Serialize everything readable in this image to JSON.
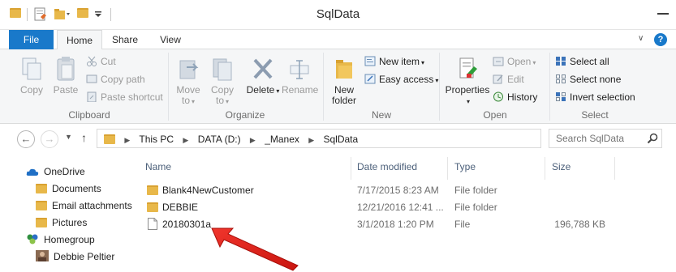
{
  "window": {
    "title": "SqlData"
  },
  "tabs": {
    "file": "File",
    "home": "Home",
    "share": "Share",
    "view": "View"
  },
  "ribbon": {
    "clipboard": {
      "label": "Clipboard",
      "copy": "Copy",
      "paste": "Paste",
      "cut": "Cut",
      "copy_path": "Copy path",
      "paste_shortcut": "Paste shortcut"
    },
    "organize": {
      "label": "Organize",
      "move_to_1": "Move",
      "move_to_2": "to",
      "copy_to_1": "Copy",
      "copy_to_2": "to",
      "delete": "Delete",
      "rename": "Rename"
    },
    "new": {
      "label": "New",
      "new_folder_1": "New",
      "new_folder_2": "folder",
      "new_item": "New item",
      "easy_access": "Easy access"
    },
    "open": {
      "label": "Open",
      "properties": "Properties",
      "open": "Open",
      "edit": "Edit",
      "history": "History"
    },
    "select": {
      "label": "Select",
      "select_all": "Select all",
      "select_none": "Select none",
      "invert": "Invert selection"
    }
  },
  "address": {
    "crumbs": [
      "This PC",
      "DATA (D:)",
      "_Manex",
      "SqlData"
    ],
    "search_placeholder": "Search SqlData"
  },
  "navpane": {
    "items": [
      "OneDrive",
      "Documents",
      "Email attachments",
      "Pictures",
      "Homegroup",
      "Debbie Peltier"
    ]
  },
  "filelist": {
    "headers": {
      "name": "Name",
      "date": "Date modified",
      "type": "Type",
      "size": "Size"
    },
    "rows": [
      {
        "name": "Blank4NewCustomer",
        "date": "7/17/2015 8:23 AM",
        "type": "File folder",
        "size": ""
      },
      {
        "name": "DEBBIE",
        "date": "12/21/2016 12:41 ...",
        "type": "File folder",
        "size": ""
      },
      {
        "name": "20180301a",
        "date": "3/1/2018 1:20 PM",
        "type": "File",
        "size": "196,788 KB"
      }
    ]
  },
  "colors": {
    "accent": "#1979ca",
    "folder": "#e8b84a",
    "arrow": "#e0241b"
  }
}
